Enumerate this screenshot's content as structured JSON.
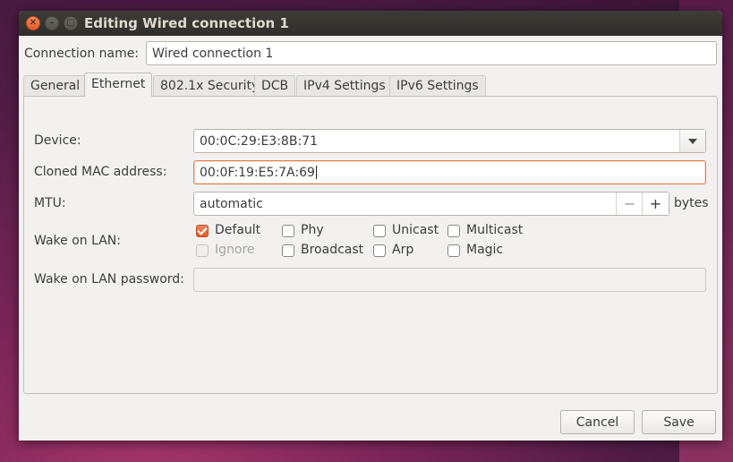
{
  "window": {
    "title": "Editing Wired connection 1"
  },
  "connection": {
    "label": "Connection name:",
    "value": "Wired connection 1"
  },
  "tabs": [
    {
      "label": "General"
    },
    {
      "label": "Ethernet"
    },
    {
      "label": "802.1x Security"
    },
    {
      "label": "DCB"
    },
    {
      "label": "IPv4 Settings"
    },
    {
      "label": "IPv6 Settings"
    }
  ],
  "ethernet": {
    "device_label": "Device:",
    "device_value": "00:0C:29:E3:8B:71",
    "cloned_label": "Cloned MAC address:",
    "cloned_value": "00:0F:19:E5:7A:69",
    "mtu_label": "MTU:",
    "mtu_value": "automatic",
    "mtu_unit": "bytes",
    "mtu_minus": "−",
    "mtu_plus": "+",
    "wol_label": "Wake on LAN:",
    "wol_options": [
      {
        "label": "Default",
        "checked": true,
        "disabled": false
      },
      {
        "label": "Phy",
        "checked": false,
        "disabled": false
      },
      {
        "label": "Unicast",
        "checked": false,
        "disabled": false
      },
      {
        "label": "Multicast",
        "checked": false,
        "disabled": false
      },
      {
        "label": "Ignore",
        "checked": false,
        "disabled": true
      },
      {
        "label": "Broadcast",
        "checked": false,
        "disabled": false
      },
      {
        "label": "Arp",
        "checked": false,
        "disabled": false
      },
      {
        "label": "Magic",
        "checked": false,
        "disabled": false
      }
    ],
    "wol_password_label": "Wake on LAN password:",
    "wol_password_value": ""
  },
  "buttons": {
    "cancel": "Cancel",
    "save": "Save"
  },
  "colors": {
    "accent": "#e15a27",
    "titlebar": "#3d3c37",
    "window_bg": "#f2f1f0"
  }
}
